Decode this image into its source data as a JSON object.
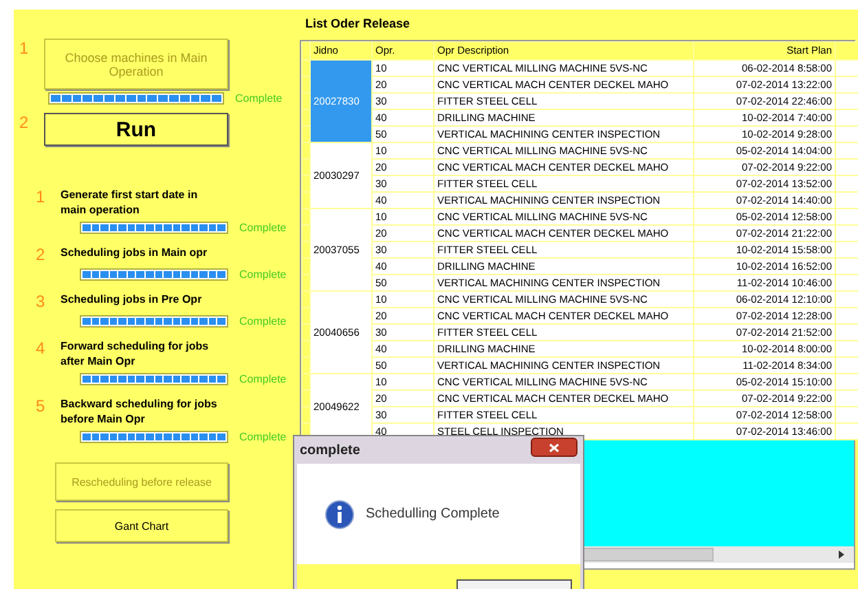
{
  "left_panel": {
    "top_steps": [
      {
        "number": "1",
        "button": {
          "label": "Choose machines in Main Operation",
          "disabled": true
        },
        "progress": {
          "level": 1,
          "status": "Complete"
        }
      },
      {
        "number": "2",
        "button": {
          "label": "Run",
          "disabled": false
        }
      }
    ],
    "steps": [
      {
        "number": "1",
        "label": "Generate first start date in main operation",
        "progress": {
          "level": 1,
          "status": "Complete"
        }
      },
      {
        "number": "2",
        "label": "Scheduling jobs in Main opr",
        "progress": {
          "level": 1,
          "status": "Complete"
        }
      },
      {
        "number": "3",
        "label": "Scheduling jobs in Pre Opr",
        "progress": {
          "level": 1,
          "status": "Complete"
        }
      },
      {
        "number": "4",
        "label": "Forward scheduling for jobs after Main Opr",
        "progress": {
          "level": 1,
          "status": "Complete"
        }
      },
      {
        "number": "5",
        "label": "Backward scheduling for jobs before Main Opr",
        "progress": {
          "level": 1,
          "status": "Complete"
        }
      }
    ],
    "buttons": [
      {
        "label": "Rescheduling before release",
        "disabled": true
      },
      {
        "label": "Gant Chart",
        "disabled": false
      }
    ]
  },
  "order_list": {
    "title": "List Oder Release",
    "columns": [
      "Jidno",
      "Opr.",
      "Opr Description",
      "Start Plan"
    ],
    "jobs": [
      {
        "jidno": "20027830",
        "selected": true,
        "ops": [
          {
            "opr": "10",
            "description": "CNC  VERTICAL MILLING MACHINE 5VS-NC",
            "start_plan": "06-02-2014 8:58:00"
          },
          {
            "opr": "20",
            "description": "CNC VERTICAL MACH CENTER DECKEL MAHO",
            "start_plan": "07-02-2014 13:22:00"
          },
          {
            "opr": "30",
            "description": "FITTER STEEL CELL",
            "start_plan": "07-02-2014 22:46:00"
          },
          {
            "opr": "40",
            "description": "DRILLING MACHINE",
            "start_plan": "10-02-2014 7:40:00"
          },
          {
            "opr": "50",
            "description": "VERTICAL MACHINING CENTER  INSPECTION",
            "start_plan": "10-02-2014 9:28:00"
          }
        ]
      },
      {
        "jidno": "20030297",
        "selected": false,
        "ops": [
          {
            "opr": "10",
            "description": "CNC  VERTICAL MILLING MACHINE 5VS-NC",
            "start_plan": "05-02-2014 14:04:00"
          },
          {
            "opr": "20",
            "description": "CNC VERTICAL MACH CENTER DECKEL MAHO",
            "start_plan": "07-02-2014 9:22:00"
          },
          {
            "opr": "30",
            "description": "FITTER STEEL CELL",
            "start_plan": "07-02-2014 13:52:00"
          },
          {
            "opr": "40",
            "description": "VERTICAL MACHINING CENTER  INSPECTION",
            "start_plan": "07-02-2014 14:40:00"
          }
        ]
      },
      {
        "jidno": "20037055",
        "selected": false,
        "ops": [
          {
            "opr": "10",
            "description": "CNC  VERTICAL MILLING MACHINE 5VS-NC",
            "start_plan": "05-02-2014 12:58:00"
          },
          {
            "opr": "20",
            "description": "CNC VERTICAL MACH CENTER DECKEL MAHO",
            "start_plan": "07-02-2014 21:22:00"
          },
          {
            "opr": "30",
            "description": "FITTER STEEL CELL",
            "start_plan": "10-02-2014 15:58:00"
          },
          {
            "opr": "40",
            "description": "DRILLING MACHINE",
            "start_plan": "10-02-2014 16:52:00"
          },
          {
            "opr": "50",
            "description": "VERTICAL MACHINING CENTER  INSPECTION",
            "start_plan": "11-02-2014 10:46:00"
          }
        ]
      },
      {
        "jidno": "20040656",
        "selected": false,
        "ops": [
          {
            "opr": "10",
            "description": "CNC  VERTICAL MILLING MACHINE 5VS-NC",
            "start_plan": "06-02-2014 12:10:00"
          },
          {
            "opr": "20",
            "description": "CNC VERTICAL MACH CENTER DECKEL MAHO",
            "start_plan": "07-02-2014 12:28:00"
          },
          {
            "opr": "30",
            "description": "FITTER STEEL CELL",
            "start_plan": "07-02-2014 21:52:00"
          },
          {
            "opr": "40",
            "description": "DRILLING MACHINE",
            "start_plan": "10-02-2014 8:00:00"
          },
          {
            "opr": "50",
            "description": "VERTICAL MACHINING CENTER  INSPECTION",
            "start_plan": "11-02-2014 8:34:00"
          }
        ]
      },
      {
        "jidno": "20049622",
        "selected": false,
        "ops": [
          {
            "opr": "10",
            "description": "CNC  VERTICAL MILLING MACHINE 5VS-NC",
            "start_plan": "05-02-2014 15:10:00"
          },
          {
            "opr": "20",
            "description": "CNC VERTICAL MACH CENTER DECKEL MAHO",
            "start_plan": "07-02-2014 9:22:00"
          },
          {
            "opr": "30",
            "description": "FITTER STEEL CELL",
            "start_plan": "07-02-2014 12:58:00"
          },
          {
            "opr": "40",
            "description": "STEEL CELL INSPECTION",
            "start_plan": "07-02-2014 13:46:00"
          }
        ]
      }
    ]
  },
  "dialog": {
    "title": "complete",
    "message": "Schedulling Complete"
  }
}
